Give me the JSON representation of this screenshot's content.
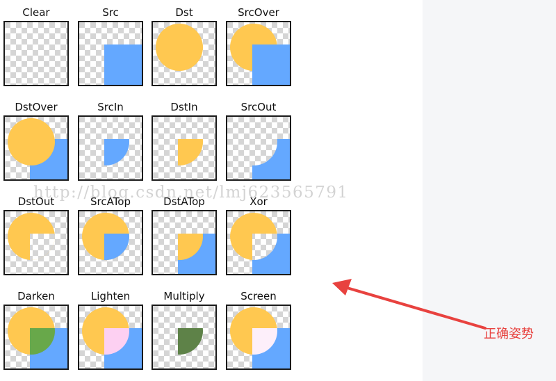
{
  "colors": {
    "dst": "#ffc850",
    "src": "#64a8ff",
    "darken_overlap": "#68a84a",
    "lighten_overlap": "#fdd0f2",
    "multiply_overlap": "#5e8248",
    "screen_overlap": "#fdeffa",
    "checker_light": "#ffffff",
    "checker_dark": "#d5d5d5",
    "arrow": "#e8423f"
  },
  "modes": [
    {
      "label": "Clear",
      "mode": "clear"
    },
    {
      "label": "Src",
      "mode": "src"
    },
    {
      "label": "Dst",
      "mode": "dst"
    },
    {
      "label": "SrcOver",
      "mode": "srcover"
    },
    {
      "label": "DstOver",
      "mode": "dstover"
    },
    {
      "label": "SrcIn",
      "mode": "srcin"
    },
    {
      "label": "DstIn",
      "mode": "dstin"
    },
    {
      "label": "SrcOut",
      "mode": "srcout"
    },
    {
      "label": "DstOut",
      "mode": "dstout"
    },
    {
      "label": "SrcATop",
      "mode": "srcatop"
    },
    {
      "label": "DstATop",
      "mode": "dstatop"
    },
    {
      "label": "Xor",
      "mode": "xor"
    },
    {
      "label": "Darken",
      "mode": "darken"
    },
    {
      "label": "Lighten",
      "mode": "lighten"
    },
    {
      "label": "Multiply",
      "mode": "multiply"
    },
    {
      "label": "Screen",
      "mode": "screen"
    }
  ],
  "watermark": "http://blog.csdn.net/lmj623565791",
  "annotation": "正确姿势"
}
